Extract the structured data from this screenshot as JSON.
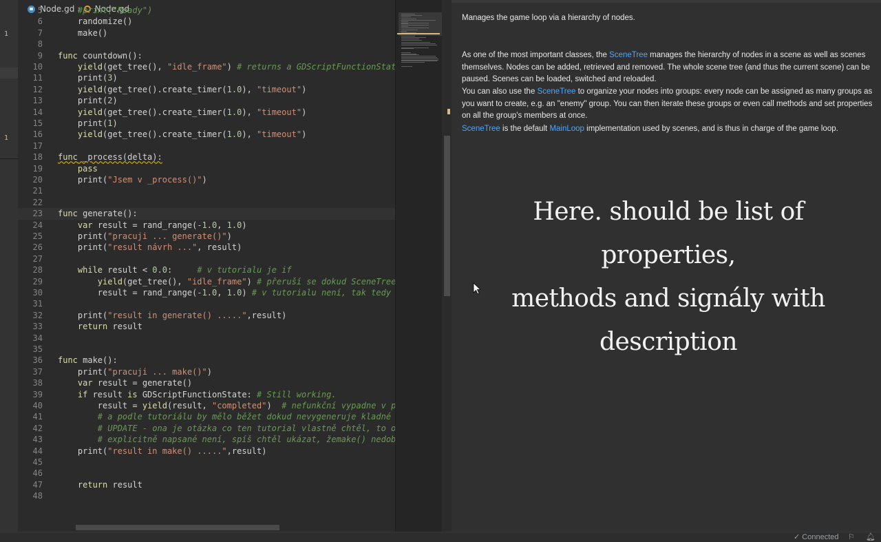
{
  "breadcrumb": {
    "file1": "Node.gd",
    "file2": "Node.gd"
  },
  "gutter_marks": [
    "1",
    "1"
  ],
  "code_lines": [
    {
      "n": "5",
      "html": "    <span class=\"cm\">#print(\"Ready\")</span>"
    },
    {
      "n": "6",
      "html": "    randomize()"
    },
    {
      "n": "7",
      "html": "    make()"
    },
    {
      "n": "8",
      "html": ""
    },
    {
      "n": "9",
      "html": "<span class=\"kw\">func</span> countdown():"
    },
    {
      "n": "10",
      "html": "    <span class=\"kw\">yield</span>(get_tree(), <span class=\"str\">\"idle_frame\"</span>) <span class=\"cm\"># returns a GDScriptFunctionState obje</span>"
    },
    {
      "n": "11",
      "html": "    print(<span class=\"num\">3</span>)"
    },
    {
      "n": "12",
      "html": "    <span class=\"kw\">yield</span>(get_tree().create_timer(<span class=\"num\">1.0</span>), <span class=\"str\">\"timeout\"</span>)"
    },
    {
      "n": "13",
      "html": "    print(<span class=\"num\">2</span>)"
    },
    {
      "n": "14",
      "html": "    <span class=\"kw\">yield</span>(get_tree().create_timer(<span class=\"num\">1.0</span>), <span class=\"str\">\"timeout\"</span>)"
    },
    {
      "n": "15",
      "html": "    print(<span class=\"num\">1</span>)"
    },
    {
      "n": "16",
      "html": "    <span class=\"kw\">yield</span>(get_tree().create_timer(<span class=\"num\">1.0</span>), <span class=\"str\">\"timeout\"</span>)"
    },
    {
      "n": "17",
      "html": ""
    },
    {
      "n": "18",
      "html": "<span class=\"squig\"><span class=\"kw\">func</span> _process(delta):</span>"
    },
    {
      "n": "19",
      "html": "    <span class=\"kw\">pass</span>"
    },
    {
      "n": "20",
      "html": "    print(<span class=\"str\">\"Jsem v _process()\"</span>)"
    },
    {
      "n": "21",
      "html": ""
    },
    {
      "n": "22",
      "html": ""
    },
    {
      "n": "23",
      "html": "<span class=\"kw\">func</span> generate():"
    },
    {
      "n": "24",
      "html": "    <span class=\"kw\">var</span> result = rand_range(<span class=\"num\">-1.0</span>, <span class=\"num\">1.0</span>)"
    },
    {
      "n": "25",
      "html": "    print(<span class=\"str\">\"pracuji ... generate()\"</span>)"
    },
    {
      "n": "26",
      "html": "    print(<span class=\"str\">\"result návrh ...\"</span>, result)"
    },
    {
      "n": "27",
      "html": ""
    },
    {
      "n": "28",
      "html": "    <span class=\"kw\">while</span> result &lt; <span class=\"num\">0.0</span>:     <span class=\"cm\"># v tutorialu je if</span>"
    },
    {
      "n": "29",
      "html": "        <span class=\"kw\">yield</span>(get_tree(), <span class=\"str\">\"idle_frame\"</span>) <span class=\"cm\"># přeruší se dokud SceneTree nevrá</span>"
    },
    {
      "n": "30",
      "html": "        result = rand_range(<span class=\"num\">-1.0</span>, <span class=\"num\">1.0</span>) <span class=\"cm\"># v tutorialu není, tak tedy nemůže</span>"
    },
    {
      "n": "31",
      "html": ""
    },
    {
      "n": "32",
      "html": "    print(<span class=\"str\">\"result in generate() .....\"</span>,result)"
    },
    {
      "n": "33",
      "html": "    <span class=\"kw\">return</span> result"
    },
    {
      "n": "34",
      "html": ""
    },
    {
      "n": "35",
      "html": ""
    },
    {
      "n": "36",
      "html": "<span class=\"kw\">func</span> make():"
    },
    {
      "n": "37",
      "html": "    print(<span class=\"str\">\"pracuji ... make()\"</span>)"
    },
    {
      "n": "38",
      "html": "    <span class=\"kw\">var</span> result = generate()"
    },
    {
      "n": "39",
      "html": "    <span class=\"kw\">if</span> result <span class=\"kw\">is</span> GDScriptFunctionState: <span class=\"cm\"># Still working.</span>"
    },
    {
      "n": "40",
      "html": "        result = <span class=\"kw\">yield</span>(result, <span class=\"str\">\"completed\"</span>)  <span class=\"cm\"># nefunkční vypadne v případn</span>"
    },
    {
      "n": "41",
      "html": "        <span class=\"cm\"># a podle tutoriálu by mělo běžet dokud nevygeneruje kladné číslo,</span>"
    },
    {
      "n": "42",
      "html": "        <span class=\"cm\"># UPDATE - ona je otázka co ten tutorial vlastně chtěl, to o výsle</span>"
    },
    {
      "n": "43",
      "html": "        <span class=\"cm\"># explicitně napsané není, spíš chtěl ukázat, žemake() nedoběhne d</span>"
    },
    {
      "n": "44",
      "html": "    print(<span class=\"str\">\"result in make() .....\"</span>,result)"
    },
    {
      "n": "45",
      "html": ""
    },
    {
      "n": "46",
      "html": ""
    },
    {
      "n": "47",
      "html": "    <span class=\"kw\">return</span> result"
    },
    {
      "n": "48",
      "html": ""
    }
  ],
  "doc": {
    "brief": "Manages the game loop via a hierarchy of nodes.",
    "p1_link": "SceneTree",
    "p1_pre": "As one of the most important classes, the ",
    "p1_post": " manages the hierarchy of nodes in a scene as well as scenes themselves. Nodes can be added, retrieved and removed. The whole scene tree (and thus the current scene) can be paused. Scenes can be loaded, switched and reloaded.",
    "p2_pre": "You can also use the ",
    "p2_link": "SceneTree",
    "p2_post": " to organize your nodes into groups: every node can be assigned as many groups as you want to create, e.g. an \"enemy\" group. You can then iterate these groups or even call methods and set properties on all the group's members at once.",
    "p3_link1": "SceneTree",
    "p3_mid": " is the default ",
    "p3_link2": "MainLoop",
    "p3_post": " implementation used by scenes, and is thus in charge of the game loop.",
    "handwriting_line1": "Here. should be list of properties,",
    "handwriting_line2": "methods and signály with",
    "handwriting_line3": "description"
  },
  "status": {
    "connected": "✓ Connected"
  },
  "icons": {
    "breadcrumb_file": "godot-script-icon",
    "breadcrumb_node": "node-icon",
    "status_feedback": "feedback-icon",
    "status_bell": "bell-icon"
  }
}
